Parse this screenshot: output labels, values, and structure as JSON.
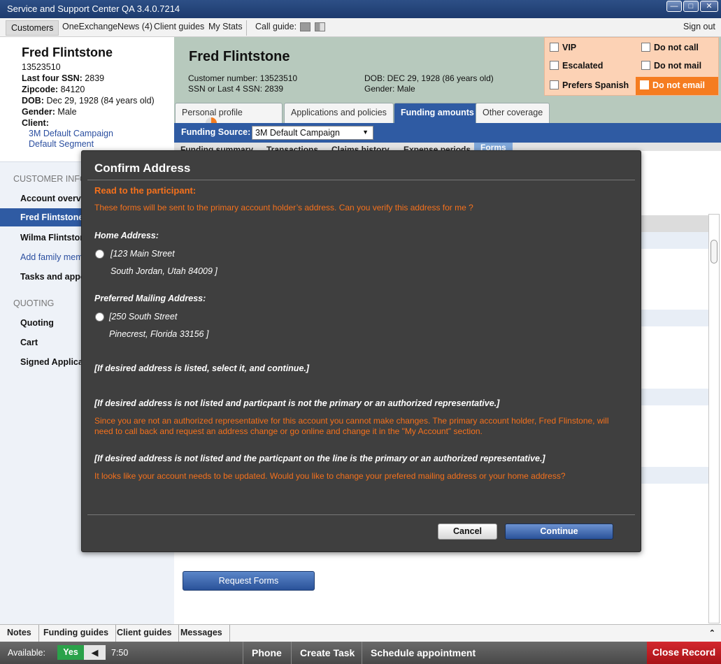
{
  "window": {
    "title": "Service and Support Center QA 3.4.0.7214",
    "buttons": [
      "—",
      "□",
      "✕"
    ]
  },
  "menu": {
    "items": [
      "Customers",
      "OneExchange",
      "News (4)",
      "Client guides",
      "My Stats"
    ],
    "call_guide": "Call guide:",
    "sign_out": "Sign out"
  },
  "customer": {
    "name": "Fred Flintstone",
    "id": "13523510",
    "ssn_label": "Last four SSN:",
    "ssn": "2839",
    "zip_label": "Zipcode:",
    "zip": "84120",
    "dob_label": "DOB:",
    "dob": "Dec 29, 1928 (84 years old)",
    "gender_label": "Gender:",
    "gender": "Male",
    "client_label": "Client:",
    "campaign": "3M Default Campaign",
    "segment": "Default Segment"
  },
  "leftnav": {
    "header_customer": "CUSTOMER INFO",
    "account_overview": "Account overview",
    "fred": "Fred Flintstone",
    "wilma": "Wilma Flintstone",
    "add_family": "Add family member",
    "tasks": "Tasks and appointments",
    "header_quoting": "QUOTING",
    "quoting": "Quoting",
    "cart": "Cart",
    "signed": "Signed Applications"
  },
  "header": {
    "name": "Fred Flintstone",
    "custnum": "Customer number: 13523510",
    "ssn": "SSN or Last 4 SSN: 2839",
    "dob": "DOB: DEC 29, 1928 (86 years old)",
    "gender": "Gender: Male"
  },
  "flags": {
    "vip": "VIP",
    "escalated": "Escalated",
    "spanish": "Prefers Spanish",
    "no_call": "Do not call",
    "no_mail": "Do not mail",
    "no_email": "Do not email"
  },
  "tabs": {
    "personal": "Personal profile",
    "applications": "Applications and policies",
    "funding": "Funding amounts",
    "other": "Other coverage"
  },
  "funding": {
    "label": "Funding Source:",
    "value": "3M Default Campaign"
  },
  "subtabs": [
    "Funding summary",
    "Transactions",
    "Claims history",
    "Expense periods",
    "Forms"
  ],
  "request_forms": "Request Forms",
  "modal": {
    "title": "Confirm Address",
    "read_label": "Read to the participant:",
    "intro": "These forms will be sent to the primary account holder’s address. Can you verify this address for me ?",
    "home_label": "Home Address:",
    "home_line1": "[123 Main Street",
    "home_line2": "South Jordan, Utah 84009 ]",
    "mail_label": "Preferred Mailing Address:",
    "mail_line1": "[250 South Street",
    "mail_line2": "Pinecrest, Florida 33156  ]",
    "instr1": "[If desired address is listed, select it, and continue.]",
    "instr2": "[If desired address is not listed and particpant is not the primary or an authorized representative.]",
    "para2": "Since you are not an authorized representative for this account you cannot make changes. The primary account holder, Fred Flinstone, will need to call back and request an address change or go online and change it in the \"My Account\" section.",
    "instr3": "[If desired address is not listed and the particpant on the line is the primary or an authorized representative.]",
    "para3": "It looks like your account needs to be updated. Would you like to change your prefered mailing address or your home address?",
    "cancel": "Cancel",
    "continue": "Continue"
  },
  "bottom_tabs": [
    "Notes",
    "Funding guides",
    "Client guides",
    "Messages"
  ],
  "status": {
    "available": "Available:",
    "yes": "Yes",
    "toggle": "◀",
    "time": "7:50",
    "phone": "Phone",
    "create_task": "Create Task",
    "schedule": "Schedule appointment",
    "close": "Close Record"
  }
}
